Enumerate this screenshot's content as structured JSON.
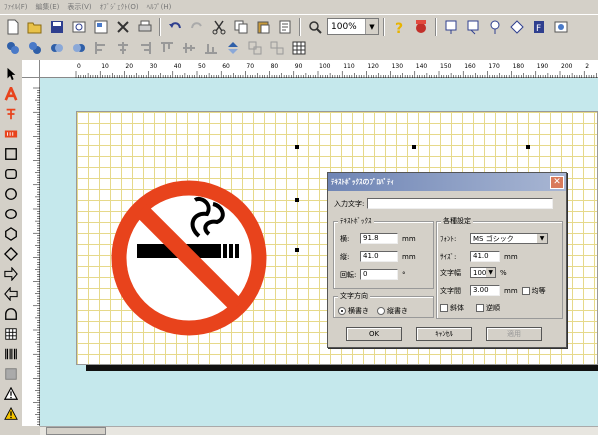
{
  "menu": [
    "ﾌｧｲﾙ(F)",
    "編集(E)",
    "表示(V)",
    "ｵﾌﾞｼﾞｪｸﾄ(O)",
    "ﾍﾙﾌﾟ(H)"
  ],
  "toolbar": {
    "zoom_value": "100%"
  },
  "ruler": {
    "h_ticks": [
      "0",
      "10",
      "20",
      "30",
      "40",
      "50",
      "60",
      "70",
      "80",
      "90",
      "100",
      "110",
      "120",
      "130",
      "140",
      "150",
      "160",
      "170",
      "180",
      "190",
      "200",
      "2"
    ]
  },
  "dialog": {
    "title": "ﾃｷｽﾄﾎﾞｯｸｽのﾌﾟﾛﾊﾟﾃｨ",
    "close_label": "✕",
    "input_label": "入力文字:",
    "input_value": "",
    "textbox_group": "ﾃｷｽﾄﾎﾞｯｸｽ",
    "width_label": "横:",
    "width_value": "91.8",
    "height_label": "縦:",
    "height_value": "41.0",
    "rotate_label": "回転:",
    "rotate_value": "0",
    "unit_mm": "mm",
    "degree": "°",
    "direction_group": "文字方向",
    "horizontal_label": "横書き",
    "vertical_label": "縦書き",
    "settings_group": "各種設定",
    "font_label": "ﾌｫﾝﾄ:",
    "font_value": "MS ゴシック",
    "size_label": "ｻｲｽﾞ:",
    "size_value": "41.0",
    "charwidth_label": "文字幅",
    "charwidth_value": "100",
    "percent": "%",
    "spacing_label": "文字間",
    "spacing_value": "3.00",
    "equal_label": "均等",
    "italic_label": "斜体",
    "reverse_label": "逆順",
    "ok_label": "OK",
    "cancel_label": "ｷｬﾝｾﾙ",
    "apply_label": "適用"
  },
  "colors": {
    "canvas_bg": "#c5e8ec",
    "grid": "#e6d98a",
    "no_smoking_red": "#e8431c"
  }
}
